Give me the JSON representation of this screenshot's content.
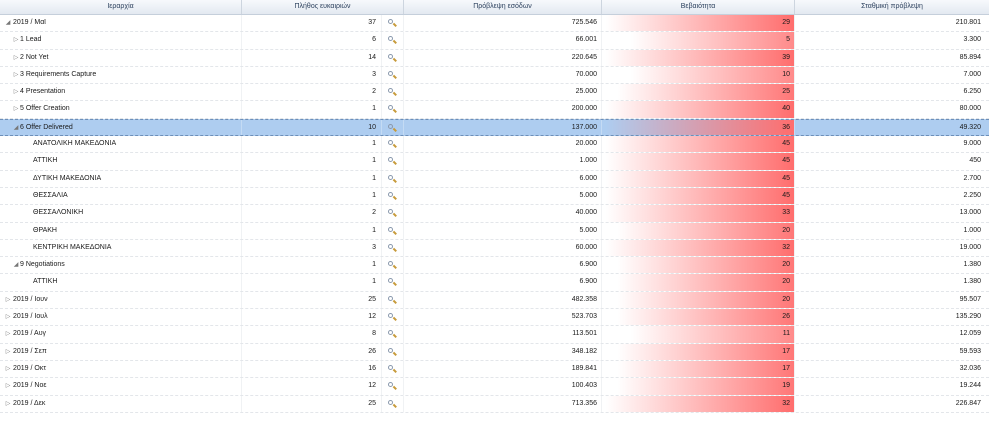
{
  "columns": [
    "Ιεραρχία",
    "Πλήθος ευκαιριών",
    "Πρόβλεψη εσόδων",
    "Βεβαιότητα",
    "Σταθμική πρόβλεψη"
  ],
  "colors": {
    "heat": "#ff6d6d",
    "selected": "#aecdf0"
  },
  "rows": [
    {
      "label": "2019 / Μαϊ",
      "level": 0,
      "toggle": "expanded",
      "count": "37",
      "revenue": "725.546",
      "certainty": "29",
      "weighted": "210.801"
    },
    {
      "label": "1  Lead",
      "level": 1,
      "toggle": "collapsed",
      "count": "6",
      "revenue": "66.001",
      "certainty": "5",
      "weighted": "3.300"
    },
    {
      "label": "2  Not Yet",
      "level": 1,
      "toggle": "collapsed",
      "count": "14",
      "revenue": "220.645",
      "certainty": "39",
      "weighted": "85.894"
    },
    {
      "label": "3  Requirements Capture",
      "level": 1,
      "toggle": "collapsed",
      "count": "3",
      "revenue": "70.000",
      "certainty": "10",
      "weighted": "7.000"
    },
    {
      "label": "4  Presentation",
      "level": 1,
      "toggle": "collapsed",
      "count": "2",
      "revenue": "25.000",
      "certainty": "25",
      "weighted": "6.250"
    },
    {
      "label": "5  Offer Creation",
      "level": 1,
      "toggle": "collapsed",
      "count": "1",
      "revenue": "200.000",
      "certainty": "40",
      "weighted": "80.000"
    },
    {
      "label": "6  Offer Delivered",
      "level": 1,
      "toggle": "expanded",
      "count": "10",
      "revenue": "137.000",
      "certainty": "36",
      "weighted": "49.320",
      "selected": true
    },
    {
      "label": "ΑΝΑΤΟΛΙΚΗ ΜΑΚΕΔΟΝΙΑ",
      "level": 2,
      "toggle": "",
      "count": "1",
      "revenue": "20.000",
      "certainty": "45",
      "weighted": "9.000"
    },
    {
      "label": "ΑΤΤΙΚΗ",
      "level": 2,
      "toggle": "",
      "count": "1",
      "revenue": "1.000",
      "certainty": "45",
      "weighted": "450"
    },
    {
      "label": "ΔΥΤΙΚΗ ΜΑΚΕΔΟΝΙΑ",
      "level": 2,
      "toggle": "",
      "count": "1",
      "revenue": "6.000",
      "certainty": "45",
      "weighted": "2.700"
    },
    {
      "label": "ΘΕΣΣΑΛΙΑ",
      "level": 2,
      "toggle": "",
      "count": "1",
      "revenue": "5.000",
      "certainty": "45",
      "weighted": "2.250"
    },
    {
      "label": "ΘΕΣΣΑΛΟΝΙΚΗ",
      "level": 2,
      "toggle": "",
      "count": "2",
      "revenue": "40.000",
      "certainty": "33",
      "weighted": "13.000"
    },
    {
      "label": "ΘΡΑΚΗ",
      "level": 2,
      "toggle": "",
      "count": "1",
      "revenue": "5.000",
      "certainty": "20",
      "weighted": "1.000"
    },
    {
      "label": "ΚΕΝΤΡΙΚΗ ΜΑΚΕΔΟΝΙΑ",
      "level": 2,
      "toggle": "",
      "count": "3",
      "revenue": "60.000",
      "certainty": "32",
      "weighted": "19.000"
    },
    {
      "label": "9  Negotiations",
      "level": 1,
      "toggle": "expanded",
      "count": "1",
      "revenue": "6.900",
      "certainty": "20",
      "weighted": "1.380"
    },
    {
      "label": "ΑΤΤΙΚΗ",
      "level": 2,
      "toggle": "",
      "count": "1",
      "revenue": "6.900",
      "certainty": "20",
      "weighted": "1.380"
    },
    {
      "label": "2019 / Ιουν",
      "level": 0,
      "toggle": "collapsed",
      "count": "25",
      "revenue": "482.358",
      "certainty": "20",
      "weighted": "95.507"
    },
    {
      "label": "2019 / Ιουλ",
      "level": 0,
      "toggle": "collapsed",
      "count": "12",
      "revenue": "523.703",
      "certainty": "26",
      "weighted": "135.290"
    },
    {
      "label": "2019 / Αυγ",
      "level": 0,
      "toggle": "collapsed",
      "count": "8",
      "revenue": "113.501",
      "certainty": "11",
      "weighted": "12.059"
    },
    {
      "label": "2019 / Σεπ",
      "level": 0,
      "toggle": "collapsed",
      "count": "26",
      "revenue": "348.182",
      "certainty": "17",
      "weighted": "59.593"
    },
    {
      "label": "2019 / Οκτ",
      "level": 0,
      "toggle": "collapsed",
      "count": "16",
      "revenue": "189.841",
      "certainty": "17",
      "weighted": "32.036"
    },
    {
      "label": "2019 / Νοε",
      "level": 0,
      "toggle": "collapsed",
      "count": "12",
      "revenue": "100.403",
      "certainty": "19",
      "weighted": "19.244"
    },
    {
      "label": "2019 / Δεκ",
      "level": 0,
      "toggle": "collapsed",
      "count": "25",
      "revenue": "713.356",
      "certainty": "32",
      "weighted": "226.847"
    }
  ]
}
